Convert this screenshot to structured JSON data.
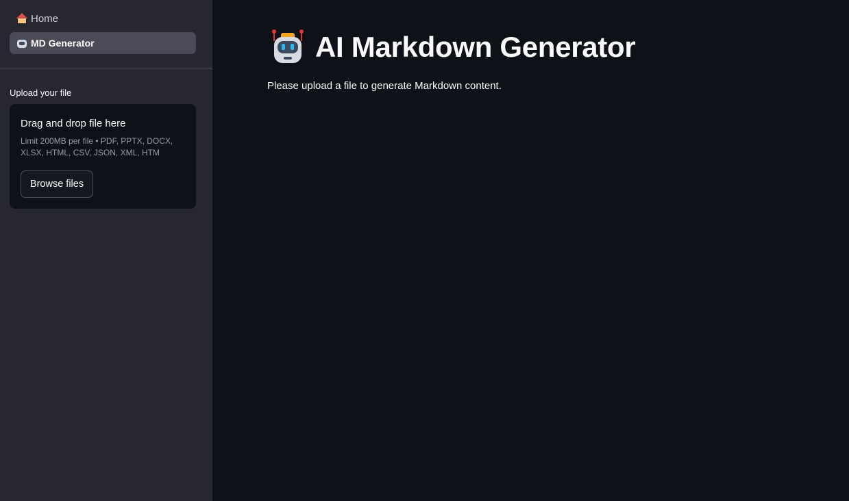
{
  "sidebar": {
    "nav": [
      {
        "label": "Home",
        "icon": "house-icon"
      },
      {
        "label": "MD Generator",
        "icon": "robot-icon",
        "selected": true
      }
    ],
    "upload": {
      "label": "Upload your file",
      "drop_title": "Drag and drop file here",
      "limits": "Limit 200MB per file • PDF, PPTX, DOCX, XLSX, HTML, CSV, JSON, XML, HTM",
      "browse_label": "Browse files"
    }
  },
  "main": {
    "title": "AI Markdown Generator",
    "title_icon": "robot-icon",
    "message": "Please upload a file to generate Markdown content."
  },
  "colors": {
    "background": "#0e1117",
    "sidebar": "#262730",
    "selected_nav": "#4a4b56",
    "text": "#fafafa"
  }
}
